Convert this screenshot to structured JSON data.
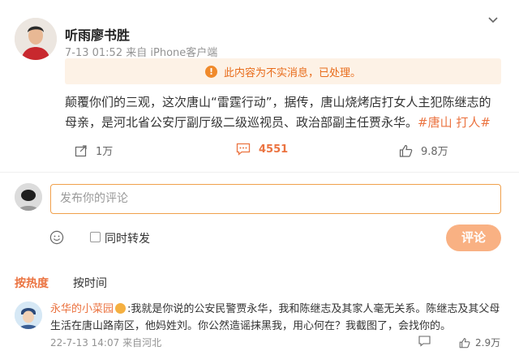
{
  "post": {
    "author": "听雨廖书胜",
    "time": "7-13 01:52",
    "source": "来自 iPhone客户端",
    "notice": "此内容为不实消息，已处理。",
    "notice_icon": "!",
    "text": "颠覆你们的三观，这次唐山“雷霆行动”，据传，唐山烧烤店打女人主犯陈继志的母亲，是河北省公安厅副厅级二级巡视员、政治部副主任贾永华。",
    "tags": "#唐山 打人#",
    "reposts": "1万",
    "comments": "4551",
    "likes": "9.8万"
  },
  "composer": {
    "placeholder": "发布你的评论",
    "repost_label": "同时转发",
    "submit_label": "评论"
  },
  "sort": {
    "hot": "按热度",
    "time": "按时间"
  },
  "comment": {
    "user": "永华的小菜园",
    "text": ":我就是你说的公安民警贾永华，我和陈继志及其家人毫无关系。陈继志及其父母生活在唐山路南区，他妈姓刘。你公然造谣抹黑我，用心何在？我截图了，会找你的。",
    "time": "22-7-13 14:07",
    "location": "来自河北",
    "likes": "2.9万"
  },
  "colors": {
    "accent": "#eb7340",
    "notice_bg": "#fdf2e6",
    "submit_bg": "#f9b183"
  }
}
